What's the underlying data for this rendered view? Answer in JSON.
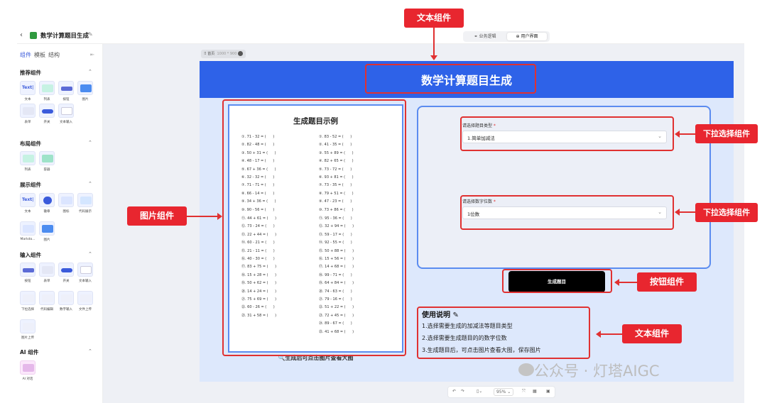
{
  "app": {
    "title": "数学计算题目生成",
    "toggle": [
      "业务逻辑",
      "用户界面"
    ],
    "frame_tab": "首页",
    "frame_size": "1000 * 900"
  },
  "sidebar": {
    "tabs": [
      "组件",
      "模板",
      "结构"
    ],
    "sections": [
      {
        "title": "推荐组件",
        "items": [
          "文本",
          "列表",
          "按钮",
          "图片",
          "表单",
          "开关",
          "文本输入"
        ]
      },
      {
        "title": "布局组件",
        "items": [
          "列表",
          "容器"
        ]
      },
      {
        "title": "展示组件",
        "items": [
          "文本",
          "徽章",
          "图标",
          "代码展示",
          "Markdo...",
          "图片"
        ]
      },
      {
        "title": "输入组件",
        "items": [
          "按钮",
          "表单",
          "开关",
          "文本输入",
          "下拉选择",
          "代码编辑",
          "数字输入",
          "文件上传",
          "图片上传"
        ]
      },
      {
        "title": "AI 组件",
        "items": [
          "AI 对话"
        ]
      }
    ]
  },
  "page": {
    "title": "数学计算题目生成",
    "image_card": {
      "title": "生成题目示例",
      "left_questions": [
        "①. 71 - 32 = (      )",
        "②. 82 - 48 = (      )",
        "③. 50 + 31 = (      )",
        "④. 48 - 17 = (      )",
        "⑤. 67 + 36 = (      )",
        "⑥. 32 - 32 = (      )",
        "⑦. 71 - 71 = (      )",
        "⑧. 66 - 14 = (      )",
        "⑨. 34 + 36 = (      )",
        "⑩. 90 - 56 = (      )",
        "⑪. 44 + 61 = (      )",
        "⑫. 73 - 24 = (      )",
        "⑬. 22 + 44 = (      )",
        "⑭. 60 - 21 = (      )",
        "⑮. 21 - 11 = (      )",
        "⑯. 40 - 30 = (      )",
        "⑰. 83 + 75 = (      )",
        "⑱. 15 + 28 = (      )",
        "⑲. 50 + 62 = (      )",
        "⑳. 14 + 24 = (      )",
        "㉑. 75 + 69 = (      )",
        "㉒. 60 - 26 = (      )",
        "㉓. 31 + 58 = (      )"
      ],
      "right_questions": [
        "①. 83 - 52 = (      )",
        "②. 41 - 35 = (      )",
        "③. 55 + 89 = (      )",
        "④. 82 + 65 = (      )",
        "⑤. 73 - 72 = (      )",
        "⑥. 93 + 81 = (      )",
        "⑦. 73 - 35 = (      )",
        "⑧. 79 + 51 = (      )",
        "⑨. 47 - 23 = (      )",
        "⑩. 73 + 86 = (      )",
        "⑪. 95 - 36 = (      )",
        "⑫. 32 + 94 = (      )",
        "⑬. 59 - 17 = (      )",
        "⑭. 92 - 55 = (      )",
        "⑮. 50 + 88 = (      )",
        "⑯. 15 + 56 = (      )",
        "⑰. 14 + 68 = (      )",
        "⑱. 99 - 71 = (      )",
        "⑲. 64 + 84 = (      )",
        "⑳. 74 - 63 = (      )",
        "㉑. 79 - 16 = (      )",
        "㉒. 51 + 22 = (      )",
        "㉓. 72 + 45 = (      )",
        "㉔. 89 - 67 = (      )",
        "㉕. 41 + 68 = (      )"
      ],
      "hint": "生成后可点击图片查看大图"
    },
    "form": {
      "type_label": "请选择题目类型",
      "type_value": "1.简单加减法",
      "digits_label": "请选择数字位数",
      "digits_value": "1位数"
    },
    "button_label": "生成题目",
    "instructions": {
      "title": "使用说明",
      "lines": [
        "1.选择需要生成的加减法等题目类型",
        "2.选择需要生成题目的的数字位数",
        "3.生成题目后，可点击图片查看大图，保存图片"
      ]
    }
  },
  "annotations": {
    "text_top": "文本组件",
    "image": "图片组件",
    "dropdown1": "下拉选择组件",
    "dropdown2": "下拉选择组件",
    "button": "按钮组件",
    "text_bottom": "文本组件"
  },
  "toolbar": {
    "zoom": "95%"
  },
  "watermark": "公众号 · 灯塔AIGC",
  "colors": {
    "header_blue": "#2e62e8",
    "annotation_red": "#e8262f",
    "page_bg": "#dde8fc"
  }
}
